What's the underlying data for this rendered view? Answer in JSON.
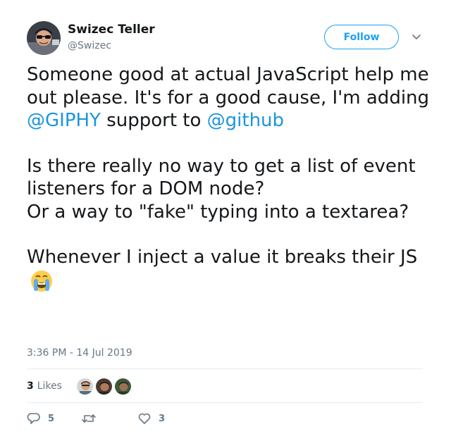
{
  "author": {
    "name": "Swizec Teller",
    "handle": "@Swizec"
  },
  "follow_label": "Follow",
  "tweet": {
    "line_1a": "Someone good at actual JavaScript help me out please. It's for a good cause, I'm adding ",
    "mention_1": "@GIPHY",
    "line_1b": " support to ",
    "mention_2": "@github",
    "para_2a": "Is there really no way to get a list of event listeners for a DOM node?",
    "para_2b": "Or a way to \"fake\" typing into a textarea?",
    "para_3": "Whenever I inject a value it breaks their JS"
  },
  "timestamp": "3:36 PM - 14 Jul 2019",
  "likes": {
    "count": "3",
    "label": "Likes"
  },
  "actions": {
    "reply_count": "5",
    "retweet_count": "",
    "like_count": "3"
  },
  "colors": {
    "accent": "#1da1f2",
    "mention": "#1b95e0",
    "secondary_text": "#657786",
    "divider": "#e6ecf0"
  },
  "icons": [
    "avatar",
    "chevron-down-icon",
    "crying-emoji",
    "reply-icon",
    "retweet-icon",
    "heart-icon"
  ]
}
